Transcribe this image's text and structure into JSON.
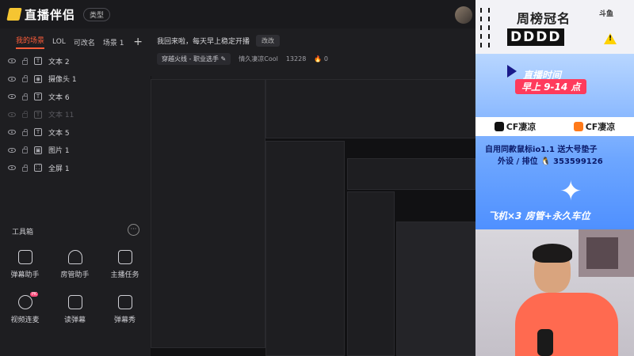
{
  "app": {
    "logo_text": "直播伴侣",
    "type_pill": "类型"
  },
  "scene_tabs": [
    "我的场景",
    "LOL",
    "可改名",
    "场景 1"
  ],
  "sources": [
    {
      "label": "文本 2",
      "icon": "T",
      "dim": false
    },
    {
      "label": "摄像头 1",
      "icon": "◉",
      "dim": false
    },
    {
      "label": "文本 6",
      "icon": "T",
      "dim": false
    },
    {
      "label": "文本 11",
      "icon": "T",
      "dim": true
    },
    {
      "label": "文本 5",
      "icon": "T",
      "dim": false
    },
    {
      "label": "图片 1",
      "icon": "▣",
      "dim": false
    },
    {
      "label": "全屏 1",
      "icon": "⛶",
      "dim": false
    }
  ],
  "toolbox": {
    "title": "工具箱",
    "more": "···",
    "tools": [
      {
        "label": "弹幕助手",
        "badge": ""
      },
      {
        "label": "房管助手",
        "badge": ""
      },
      {
        "label": "主播任务",
        "badge": ""
      },
      {
        "label": "视频连麦",
        "badge": "PK"
      },
      {
        "label": "读弹幕",
        "badge": ""
      },
      {
        "label": "弹幕秀",
        "badge": ""
      }
    ]
  },
  "stream_info": {
    "title": "我回来啦，每天早上稳定开播",
    "edit_label": "改改",
    "category": "穿越火线 - 职业选手",
    "nickname": "情久凄凉Cool",
    "room_id": "13228",
    "heat": "0"
  },
  "overlay": {
    "weekly_title": "周榜冠名",
    "weekly_name": "DDDD",
    "douyu": "斗鱼",
    "warn": "!",
    "live_time_label": "直播时间",
    "live_time": "早上 9-14 点",
    "social_1": "CF凄凉",
    "social_2": "CF凄凉",
    "mouse_line": "自用同款鼠标io1.1  送大号垫子",
    "qq_line": "外设 / 排位",
    "qq_number": "353599126",
    "perks": "飞机×3  房管+永久车位",
    "colors": {
      "accent": "#ff5d3a",
      "live_time_bg": "#ff3b5c",
      "panel_blue": "#6da6ff"
    }
  }
}
